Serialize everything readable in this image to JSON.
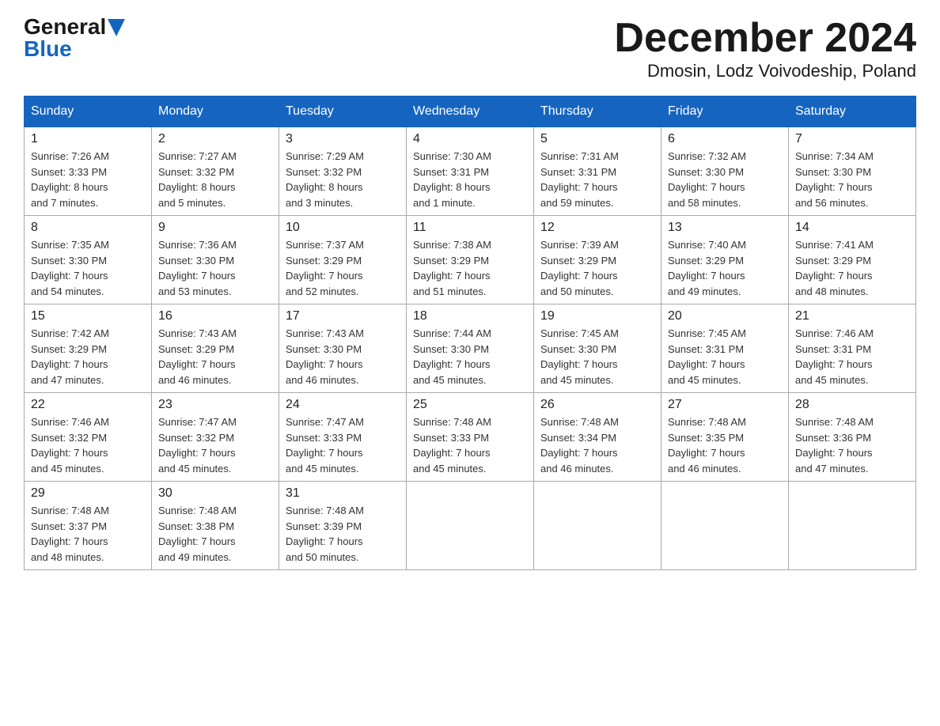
{
  "header": {
    "logo_general": "General",
    "logo_blue": "Blue",
    "title": "December 2024",
    "subtitle": "Dmosin, Lodz Voivodeship, Poland"
  },
  "columns": [
    "Sunday",
    "Monday",
    "Tuesday",
    "Wednesday",
    "Thursday",
    "Friday",
    "Saturday"
  ],
  "weeks": [
    [
      {
        "day": "1",
        "info": "Sunrise: 7:26 AM\nSunset: 3:33 PM\nDaylight: 8 hours\nand 7 minutes."
      },
      {
        "day": "2",
        "info": "Sunrise: 7:27 AM\nSunset: 3:32 PM\nDaylight: 8 hours\nand 5 minutes."
      },
      {
        "day": "3",
        "info": "Sunrise: 7:29 AM\nSunset: 3:32 PM\nDaylight: 8 hours\nand 3 minutes."
      },
      {
        "day": "4",
        "info": "Sunrise: 7:30 AM\nSunset: 3:31 PM\nDaylight: 8 hours\nand 1 minute."
      },
      {
        "day": "5",
        "info": "Sunrise: 7:31 AM\nSunset: 3:31 PM\nDaylight: 7 hours\nand 59 minutes."
      },
      {
        "day": "6",
        "info": "Sunrise: 7:32 AM\nSunset: 3:30 PM\nDaylight: 7 hours\nand 58 minutes."
      },
      {
        "day": "7",
        "info": "Sunrise: 7:34 AM\nSunset: 3:30 PM\nDaylight: 7 hours\nand 56 minutes."
      }
    ],
    [
      {
        "day": "8",
        "info": "Sunrise: 7:35 AM\nSunset: 3:30 PM\nDaylight: 7 hours\nand 54 minutes."
      },
      {
        "day": "9",
        "info": "Sunrise: 7:36 AM\nSunset: 3:30 PM\nDaylight: 7 hours\nand 53 minutes."
      },
      {
        "day": "10",
        "info": "Sunrise: 7:37 AM\nSunset: 3:29 PM\nDaylight: 7 hours\nand 52 minutes."
      },
      {
        "day": "11",
        "info": "Sunrise: 7:38 AM\nSunset: 3:29 PM\nDaylight: 7 hours\nand 51 minutes."
      },
      {
        "day": "12",
        "info": "Sunrise: 7:39 AM\nSunset: 3:29 PM\nDaylight: 7 hours\nand 50 minutes."
      },
      {
        "day": "13",
        "info": "Sunrise: 7:40 AM\nSunset: 3:29 PM\nDaylight: 7 hours\nand 49 minutes."
      },
      {
        "day": "14",
        "info": "Sunrise: 7:41 AM\nSunset: 3:29 PM\nDaylight: 7 hours\nand 48 minutes."
      }
    ],
    [
      {
        "day": "15",
        "info": "Sunrise: 7:42 AM\nSunset: 3:29 PM\nDaylight: 7 hours\nand 47 minutes."
      },
      {
        "day": "16",
        "info": "Sunrise: 7:43 AM\nSunset: 3:29 PM\nDaylight: 7 hours\nand 46 minutes."
      },
      {
        "day": "17",
        "info": "Sunrise: 7:43 AM\nSunset: 3:30 PM\nDaylight: 7 hours\nand 46 minutes."
      },
      {
        "day": "18",
        "info": "Sunrise: 7:44 AM\nSunset: 3:30 PM\nDaylight: 7 hours\nand 45 minutes."
      },
      {
        "day": "19",
        "info": "Sunrise: 7:45 AM\nSunset: 3:30 PM\nDaylight: 7 hours\nand 45 minutes."
      },
      {
        "day": "20",
        "info": "Sunrise: 7:45 AM\nSunset: 3:31 PM\nDaylight: 7 hours\nand 45 minutes."
      },
      {
        "day": "21",
        "info": "Sunrise: 7:46 AM\nSunset: 3:31 PM\nDaylight: 7 hours\nand 45 minutes."
      }
    ],
    [
      {
        "day": "22",
        "info": "Sunrise: 7:46 AM\nSunset: 3:32 PM\nDaylight: 7 hours\nand 45 minutes."
      },
      {
        "day": "23",
        "info": "Sunrise: 7:47 AM\nSunset: 3:32 PM\nDaylight: 7 hours\nand 45 minutes."
      },
      {
        "day": "24",
        "info": "Sunrise: 7:47 AM\nSunset: 3:33 PM\nDaylight: 7 hours\nand 45 minutes."
      },
      {
        "day": "25",
        "info": "Sunrise: 7:48 AM\nSunset: 3:33 PM\nDaylight: 7 hours\nand 45 minutes."
      },
      {
        "day": "26",
        "info": "Sunrise: 7:48 AM\nSunset: 3:34 PM\nDaylight: 7 hours\nand 46 minutes."
      },
      {
        "day": "27",
        "info": "Sunrise: 7:48 AM\nSunset: 3:35 PM\nDaylight: 7 hours\nand 46 minutes."
      },
      {
        "day": "28",
        "info": "Sunrise: 7:48 AM\nSunset: 3:36 PM\nDaylight: 7 hours\nand 47 minutes."
      }
    ],
    [
      {
        "day": "29",
        "info": "Sunrise: 7:48 AM\nSunset: 3:37 PM\nDaylight: 7 hours\nand 48 minutes."
      },
      {
        "day": "30",
        "info": "Sunrise: 7:48 AM\nSunset: 3:38 PM\nDaylight: 7 hours\nand 49 minutes."
      },
      {
        "day": "31",
        "info": "Sunrise: 7:48 AM\nSunset: 3:39 PM\nDaylight: 7 hours\nand 50 minutes."
      },
      {
        "day": "",
        "info": ""
      },
      {
        "day": "",
        "info": ""
      },
      {
        "day": "",
        "info": ""
      },
      {
        "day": "",
        "info": ""
      }
    ]
  ]
}
